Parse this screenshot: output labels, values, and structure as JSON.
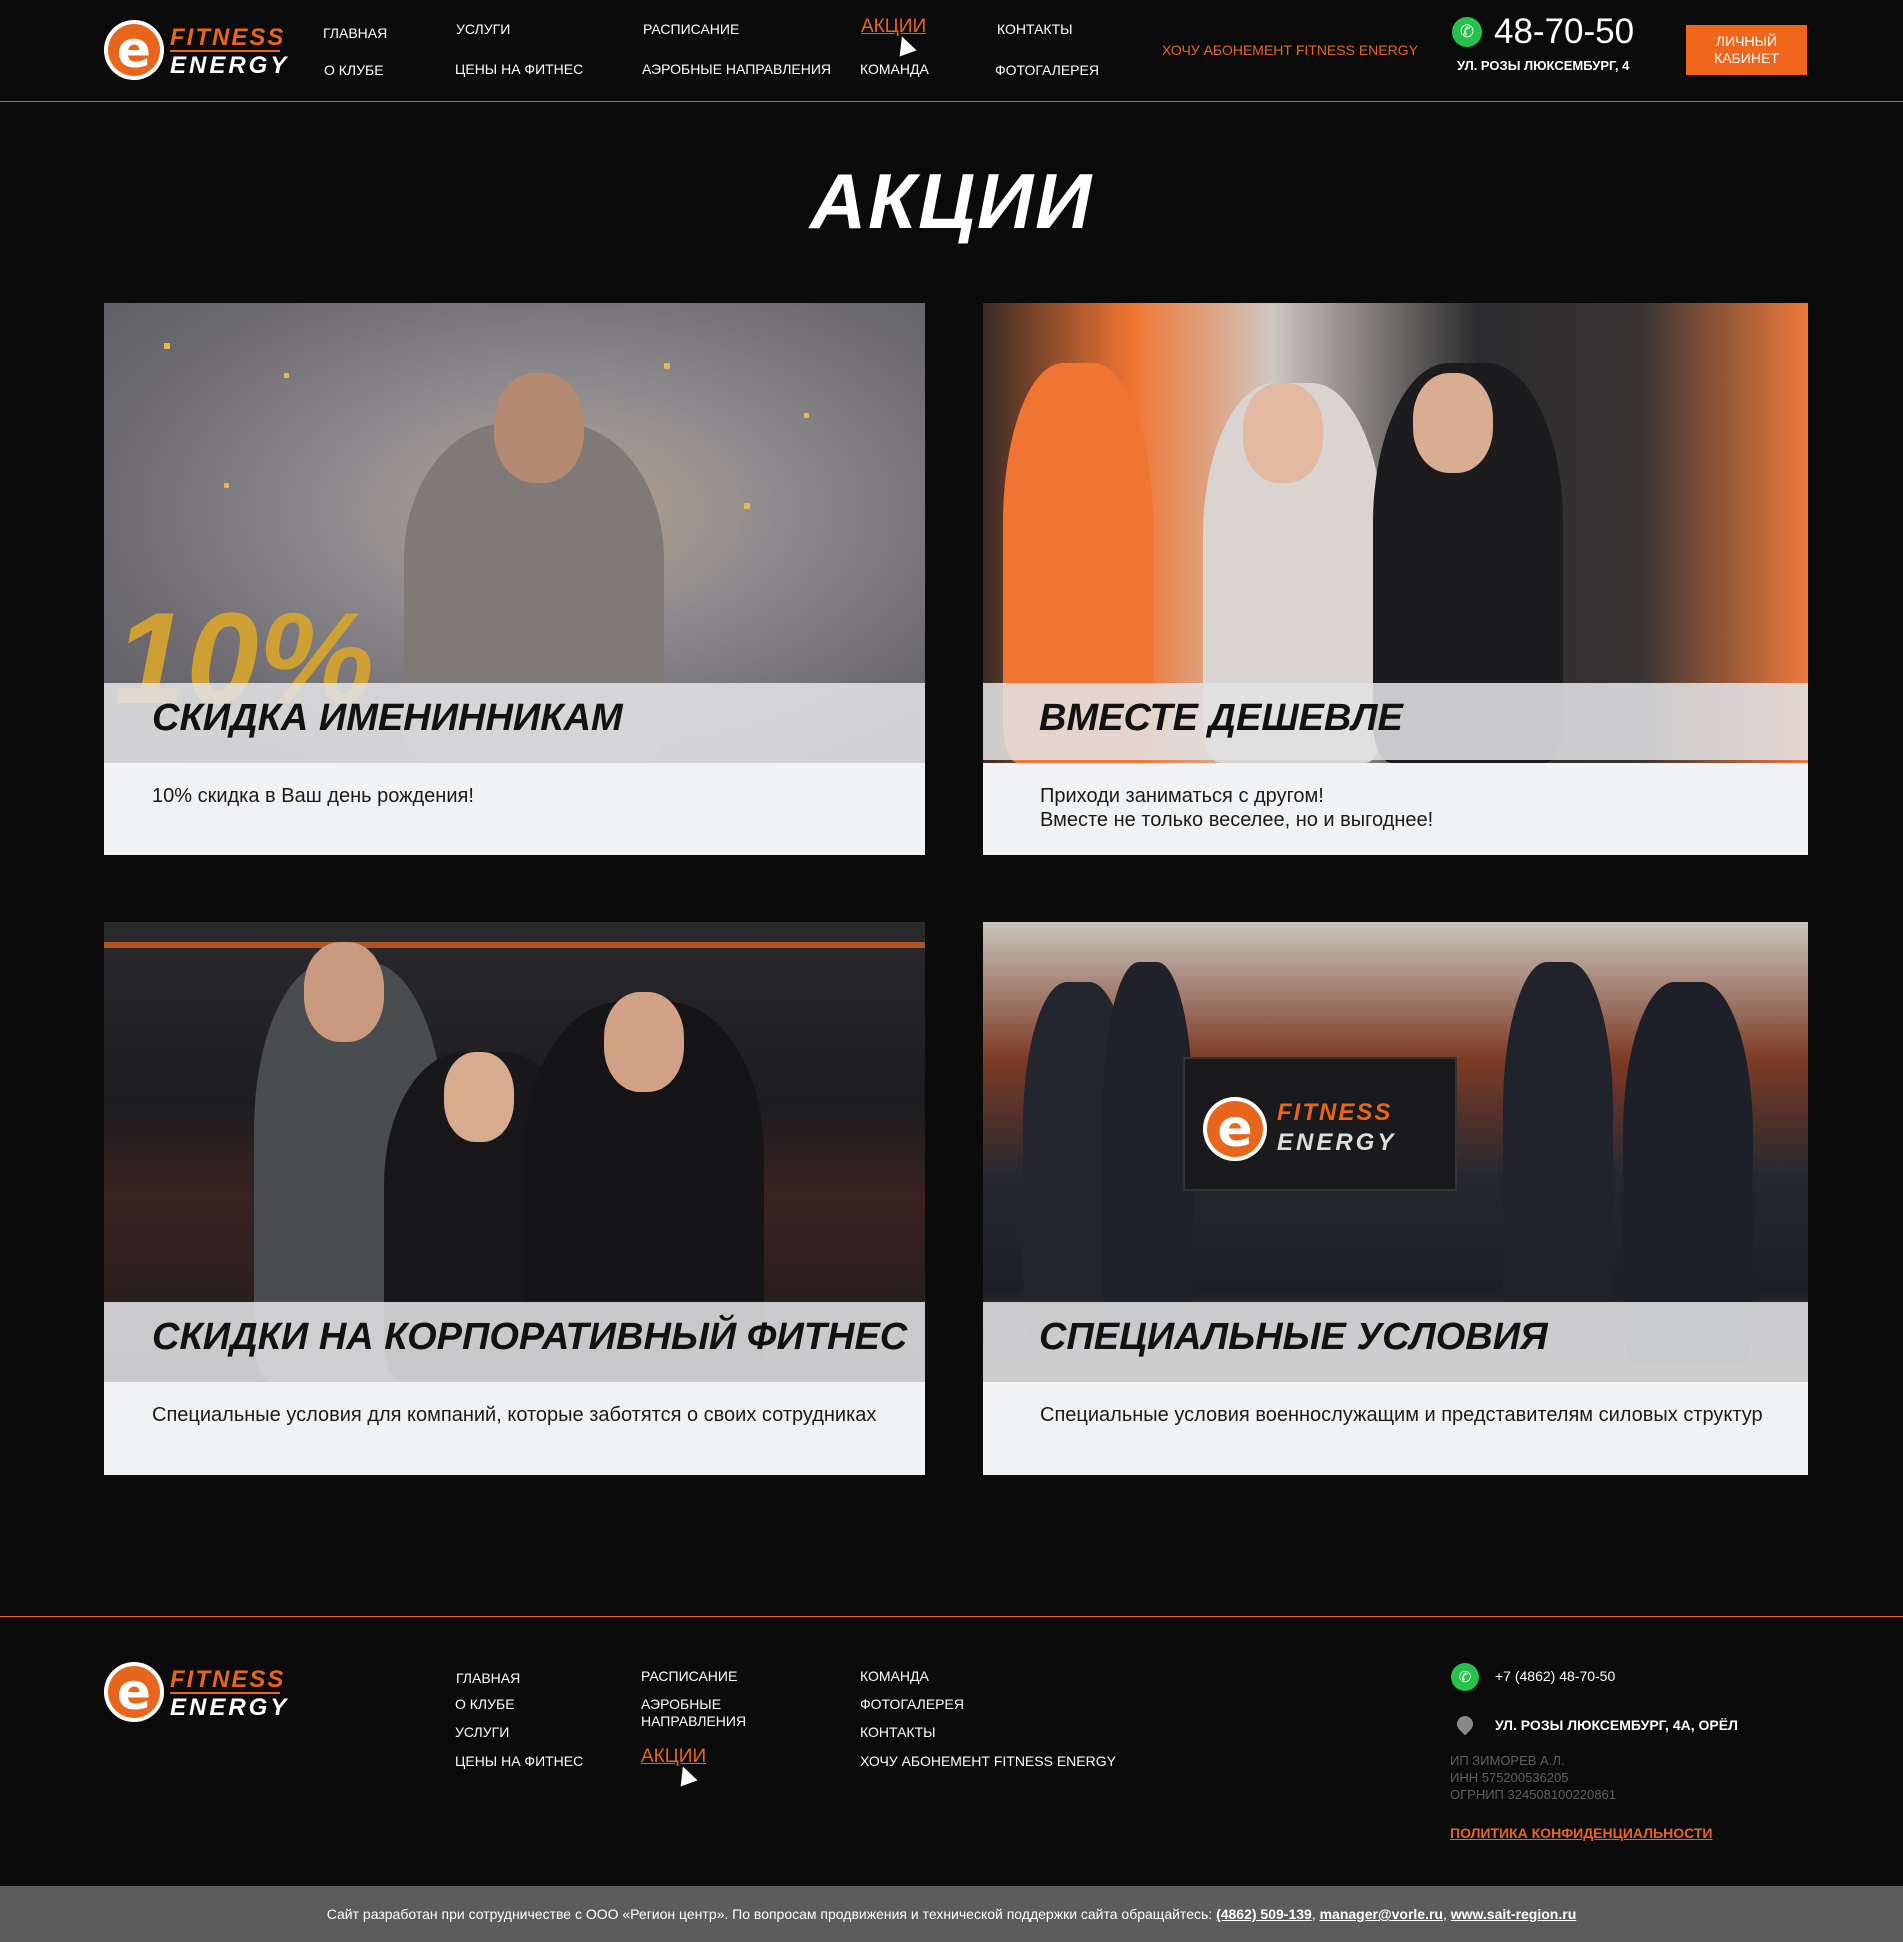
{
  "header": {
    "logo": {
      "line1": "FITNESS",
      "line2": "ENERGY",
      "mark": "e"
    },
    "nav": {
      "home": "ГЛАВНАЯ",
      "about": "О КЛУБЕ",
      "services": "УСЛУГИ",
      "prices": "ЦЕНЫ НА ФИТНЕС",
      "schedule": "РАСПИСАНИЕ",
      "aerobic": "АЭРОБНЫЕ НАПРАВЛЕНИЯ",
      "promos": "АКЦИИ",
      "team": "КОМАНДА",
      "contacts": "КОНТАКТЫ",
      "gallery": "ФОТОГАЛЕРЕЯ"
    },
    "subscription_cta": "ХОЧУ АБОНЕМЕНТ FITNESS ENERGY",
    "phone": "48-70-50",
    "address": "УЛ. РОЗЫ ЛЮКСЕМБУРГ, 4",
    "cabinet_button": "ЛИЧНЫЙ КАБИНЕТ",
    "whatsapp_icon": "whatsapp-icon"
  },
  "page": {
    "title": "АКЦИИ"
  },
  "promos": [
    {
      "title": "СКИДКА ИМЕНИННИКАМ",
      "description": "10% скидка в Ваш день рождения!",
      "overlay_text": "10%"
    },
    {
      "title": "ВМЕСТЕ ДЕШЕВЛЕ",
      "description_line1": "Приходи заниматься с другом!",
      "description_line2": "Вместе не только веселее, но и выгоднее!"
    },
    {
      "title": "СКИДКИ НА КОРПОРАТИВНЫЙ ФИТНЕС",
      "description": "Специальные условия для компаний, которые заботятся о своих сотрудниках"
    },
    {
      "title": "СПЕЦИАЛЬНЫЕ УСЛОВИЯ",
      "description": "Специальные условия военнослужащим и представителям силовых структур"
    }
  ],
  "footer": {
    "logo": {
      "line1": "FITNESS",
      "line2": "ENERGY",
      "mark": "e"
    },
    "nav": {
      "home": "ГЛАВНАЯ",
      "about": "О КЛУБЕ",
      "services": "УСЛУГИ",
      "prices": "ЦЕНЫ НА ФИТНЕС",
      "schedule": "РАСПИСАНИЕ",
      "aerobic_line1": "АЭРОБНЫЕ",
      "aerobic_line2": "НАПРАВЛЕНИЯ",
      "promos": "АКЦИИ",
      "team": "КОМАНДА",
      "gallery": "ФОТОГАЛЕРЕЯ",
      "contacts": "КОНТАКТЫ",
      "subscription": "ХОЧУ АБОНЕМЕНТ FITNESS ENERGY"
    },
    "phone": "+7 (4862) 48-70-50",
    "address": "УЛ. РОЗЫ ЛЮКСЕМБУРГ, 4А, ОРЁЛ",
    "legal_line1": "ИП ЗИМОРЕВ А.Л.",
    "legal_line2": "ИНН 575200536205",
    "legal_line3": "ОГРНИП 324508100220861",
    "privacy": "ПОЛИТИКА КОНФИДЕНЦИАЛЬНОСТИ"
  },
  "bottom_bar": {
    "text": "Сайт разработан при сотрудничестве с ООО «Регион центр». По вопросам продвижения и технической поддержки сайта обращайтесь: ",
    "phone": "(4862) 509-139",
    "email": "manager@vorle.ru",
    "site": "www.sait-region.ru"
  },
  "colors": {
    "accent": "#e8661b",
    "background": "#0b0b0b",
    "card": "#f1f2f4",
    "whatsapp": "#27c24c"
  }
}
